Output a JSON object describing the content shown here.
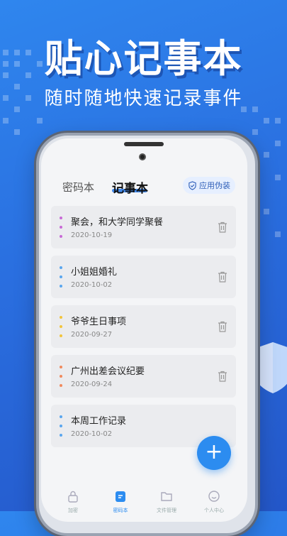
{
  "banner": {
    "headline": "贴心记事本",
    "subline": "随时随地快速记录事件"
  },
  "header": {
    "tabs": [
      {
        "label": "密码本",
        "active": false
      },
      {
        "label": "记事本",
        "active": true
      }
    ],
    "disguise_button": "应用伪装"
  },
  "notes": [
    {
      "title": "聚会，和大学同学聚餐",
      "date": "2020-10-19",
      "color": "#c86ad6"
    },
    {
      "title": "小姐姐婚礼",
      "date": "2020-10-02",
      "color": "#5aa6ee"
    },
    {
      "title": "爷爷生日事项",
      "date": "2020-09-27",
      "color": "#f2c43c"
    },
    {
      "title": "广州出差会议纪要",
      "date": "2020-09-24",
      "color": "#f08a5d"
    },
    {
      "title": "本周工作记录",
      "date": "2020-10-02",
      "color": "#5aa6ee"
    }
  ],
  "fab": {
    "icon": "plus-icon"
  },
  "bottom_nav": [
    {
      "label": "加密",
      "icon": "lock-icon",
      "active": false
    },
    {
      "label": "密码本",
      "icon": "note-icon",
      "active": true
    },
    {
      "label": "文件管理",
      "icon": "folder-icon",
      "active": false
    },
    {
      "label": "个人中心",
      "icon": "smile-icon",
      "active": false
    }
  ],
  "colors": {
    "accent": "#2c8cf0",
    "background": "#2f86ee"
  }
}
